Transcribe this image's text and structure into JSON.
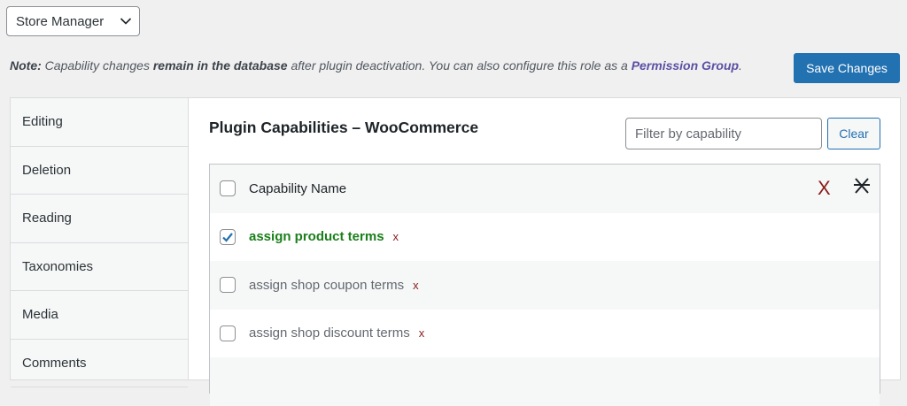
{
  "role_selector": {
    "value": "Store Manager"
  },
  "note": {
    "label": "Note:",
    "part1": " Capability changes ",
    "bold1": "remain in the database",
    "part2": " after plugin deactivation. You can also configure this role as a ",
    "link": "Permission Group",
    "end": "."
  },
  "save_button": {
    "label": "Save Changes"
  },
  "sidebar": {
    "items": [
      {
        "label": "Editing"
      },
      {
        "label": "Deletion"
      },
      {
        "label": "Reading"
      },
      {
        "label": "Taxonomies"
      },
      {
        "label": "Media"
      },
      {
        "label": "Comments"
      }
    ]
  },
  "section": {
    "title": "Plugin Capabilities – WooCommerce",
    "filter_placeholder": "Filter by capability",
    "clear_label": "Clear"
  },
  "table": {
    "header": {
      "label": "Capability Name",
      "deny_mark": "X",
      "clear_mark": "X"
    },
    "rows": [
      {
        "label": "assign product terms",
        "checked": true,
        "deny_mark": "x"
      },
      {
        "label": "assign shop coupon terms",
        "checked": false,
        "deny_mark": "x"
      },
      {
        "label": "assign shop discount terms",
        "checked": false,
        "deny_mark": "x"
      }
    ]
  },
  "colors": {
    "primary": "#2271b1",
    "granted": "#1a7f1a",
    "deny": "#8a1c1c",
    "link": "#5b4fa3"
  }
}
